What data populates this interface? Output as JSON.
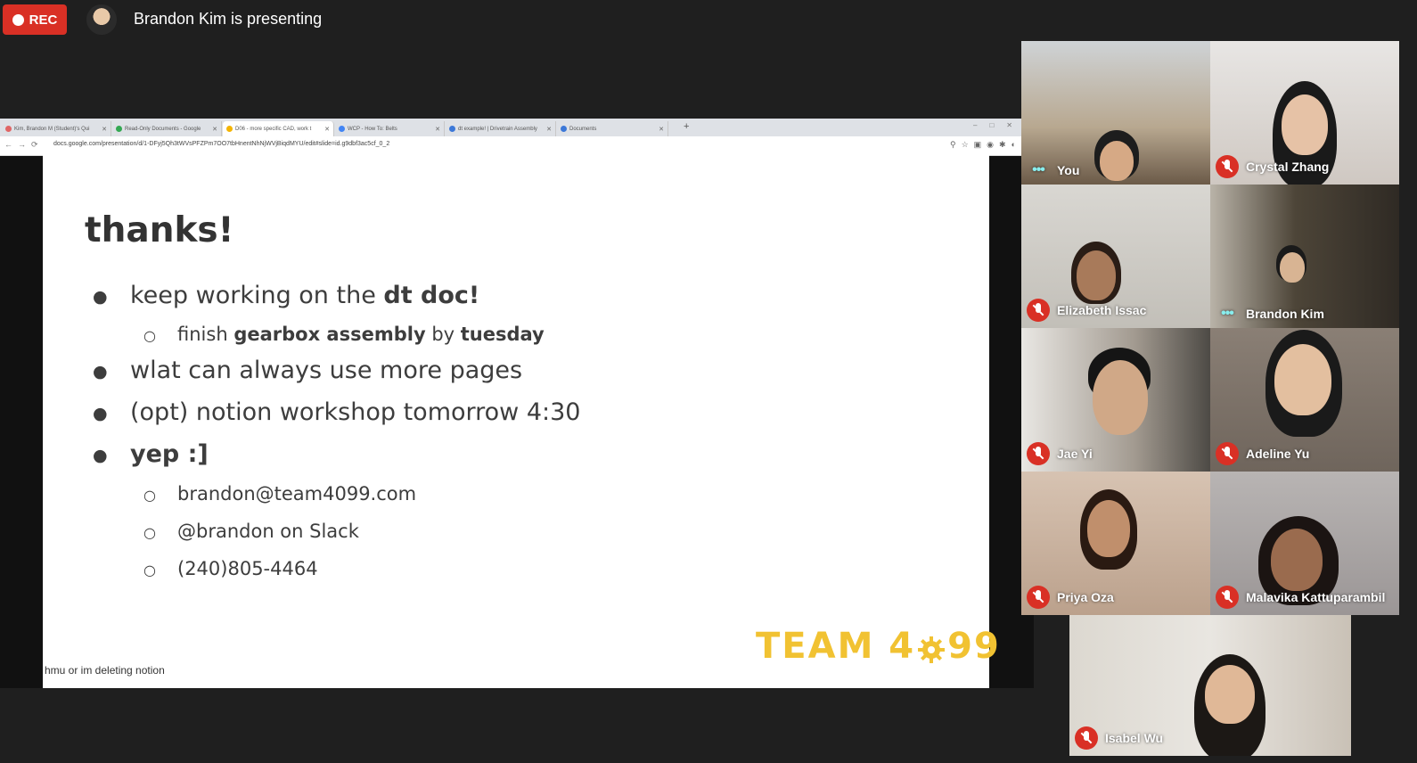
{
  "topbar": {
    "rec_label": "REC",
    "presenter_text": "Brandon Kim is presenting"
  },
  "browser": {
    "tabs": [
      {
        "label": "Kim, Brandon M (Student)'s Qui",
        "color": "#e06666"
      },
      {
        "label": "Read-Only Documents - Google",
        "color": "#34a853"
      },
      {
        "label": "D06 - more specific CAD, work t",
        "color": "#f4b400"
      },
      {
        "label": "WCP - How To: Belts",
        "color": "#4285f4"
      },
      {
        "label": "dt example! | Drivetrain Assembly",
        "color": "#3c78d8"
      },
      {
        "label": "Documents",
        "color": "#3c78d8"
      }
    ],
    "url": "docs.google.com/presentation/d/1-DFyj5Qh3tWVsPFZPm7OO7tbHnentNhNjWVjBiqdMYU/edit#slide=id.g9dbf3ac5cf_0_2"
  },
  "slide": {
    "title": "thanks!",
    "bullet1_pre": "keep working on the ",
    "bullet1_bold": "dt doc!",
    "sub1_pre": "finish ",
    "sub1_bold1": "gearbox assembly",
    "sub1_mid": " by ",
    "sub1_bold2": "tuesday",
    "bullet2": "wlat can always use more pages",
    "bullet3": "(opt) notion workshop tomorrow 4:30",
    "bullet4": "yep :]",
    "contact1": "brandon@team4099.com",
    "contact2": "@brandon on Slack",
    "contact3": "(240)805-4464",
    "logo_left": "TEAM 4",
    "logo_right": "99",
    "caption": "hmu or im deleting notion"
  },
  "participants": [
    {
      "name": "You",
      "state": "speaking"
    },
    {
      "name": "Crystal Zhang",
      "state": "muted"
    },
    {
      "name": "Elizabeth Issac",
      "state": "muted"
    },
    {
      "name": "Brandon Kim",
      "state": "speaking"
    },
    {
      "name": "Jae Yi",
      "state": "muted"
    },
    {
      "name": "Adeline Yu",
      "state": "muted"
    },
    {
      "name": "Priya Oza",
      "state": "muted"
    },
    {
      "name": "Malavika Kattuparambil",
      "state": "muted"
    },
    {
      "name": "Isabel Wu",
      "state": "muted"
    }
  ],
  "colors": {
    "rec": "#d93025",
    "logo": "#f1c232",
    "background": "#1f1f1f"
  }
}
